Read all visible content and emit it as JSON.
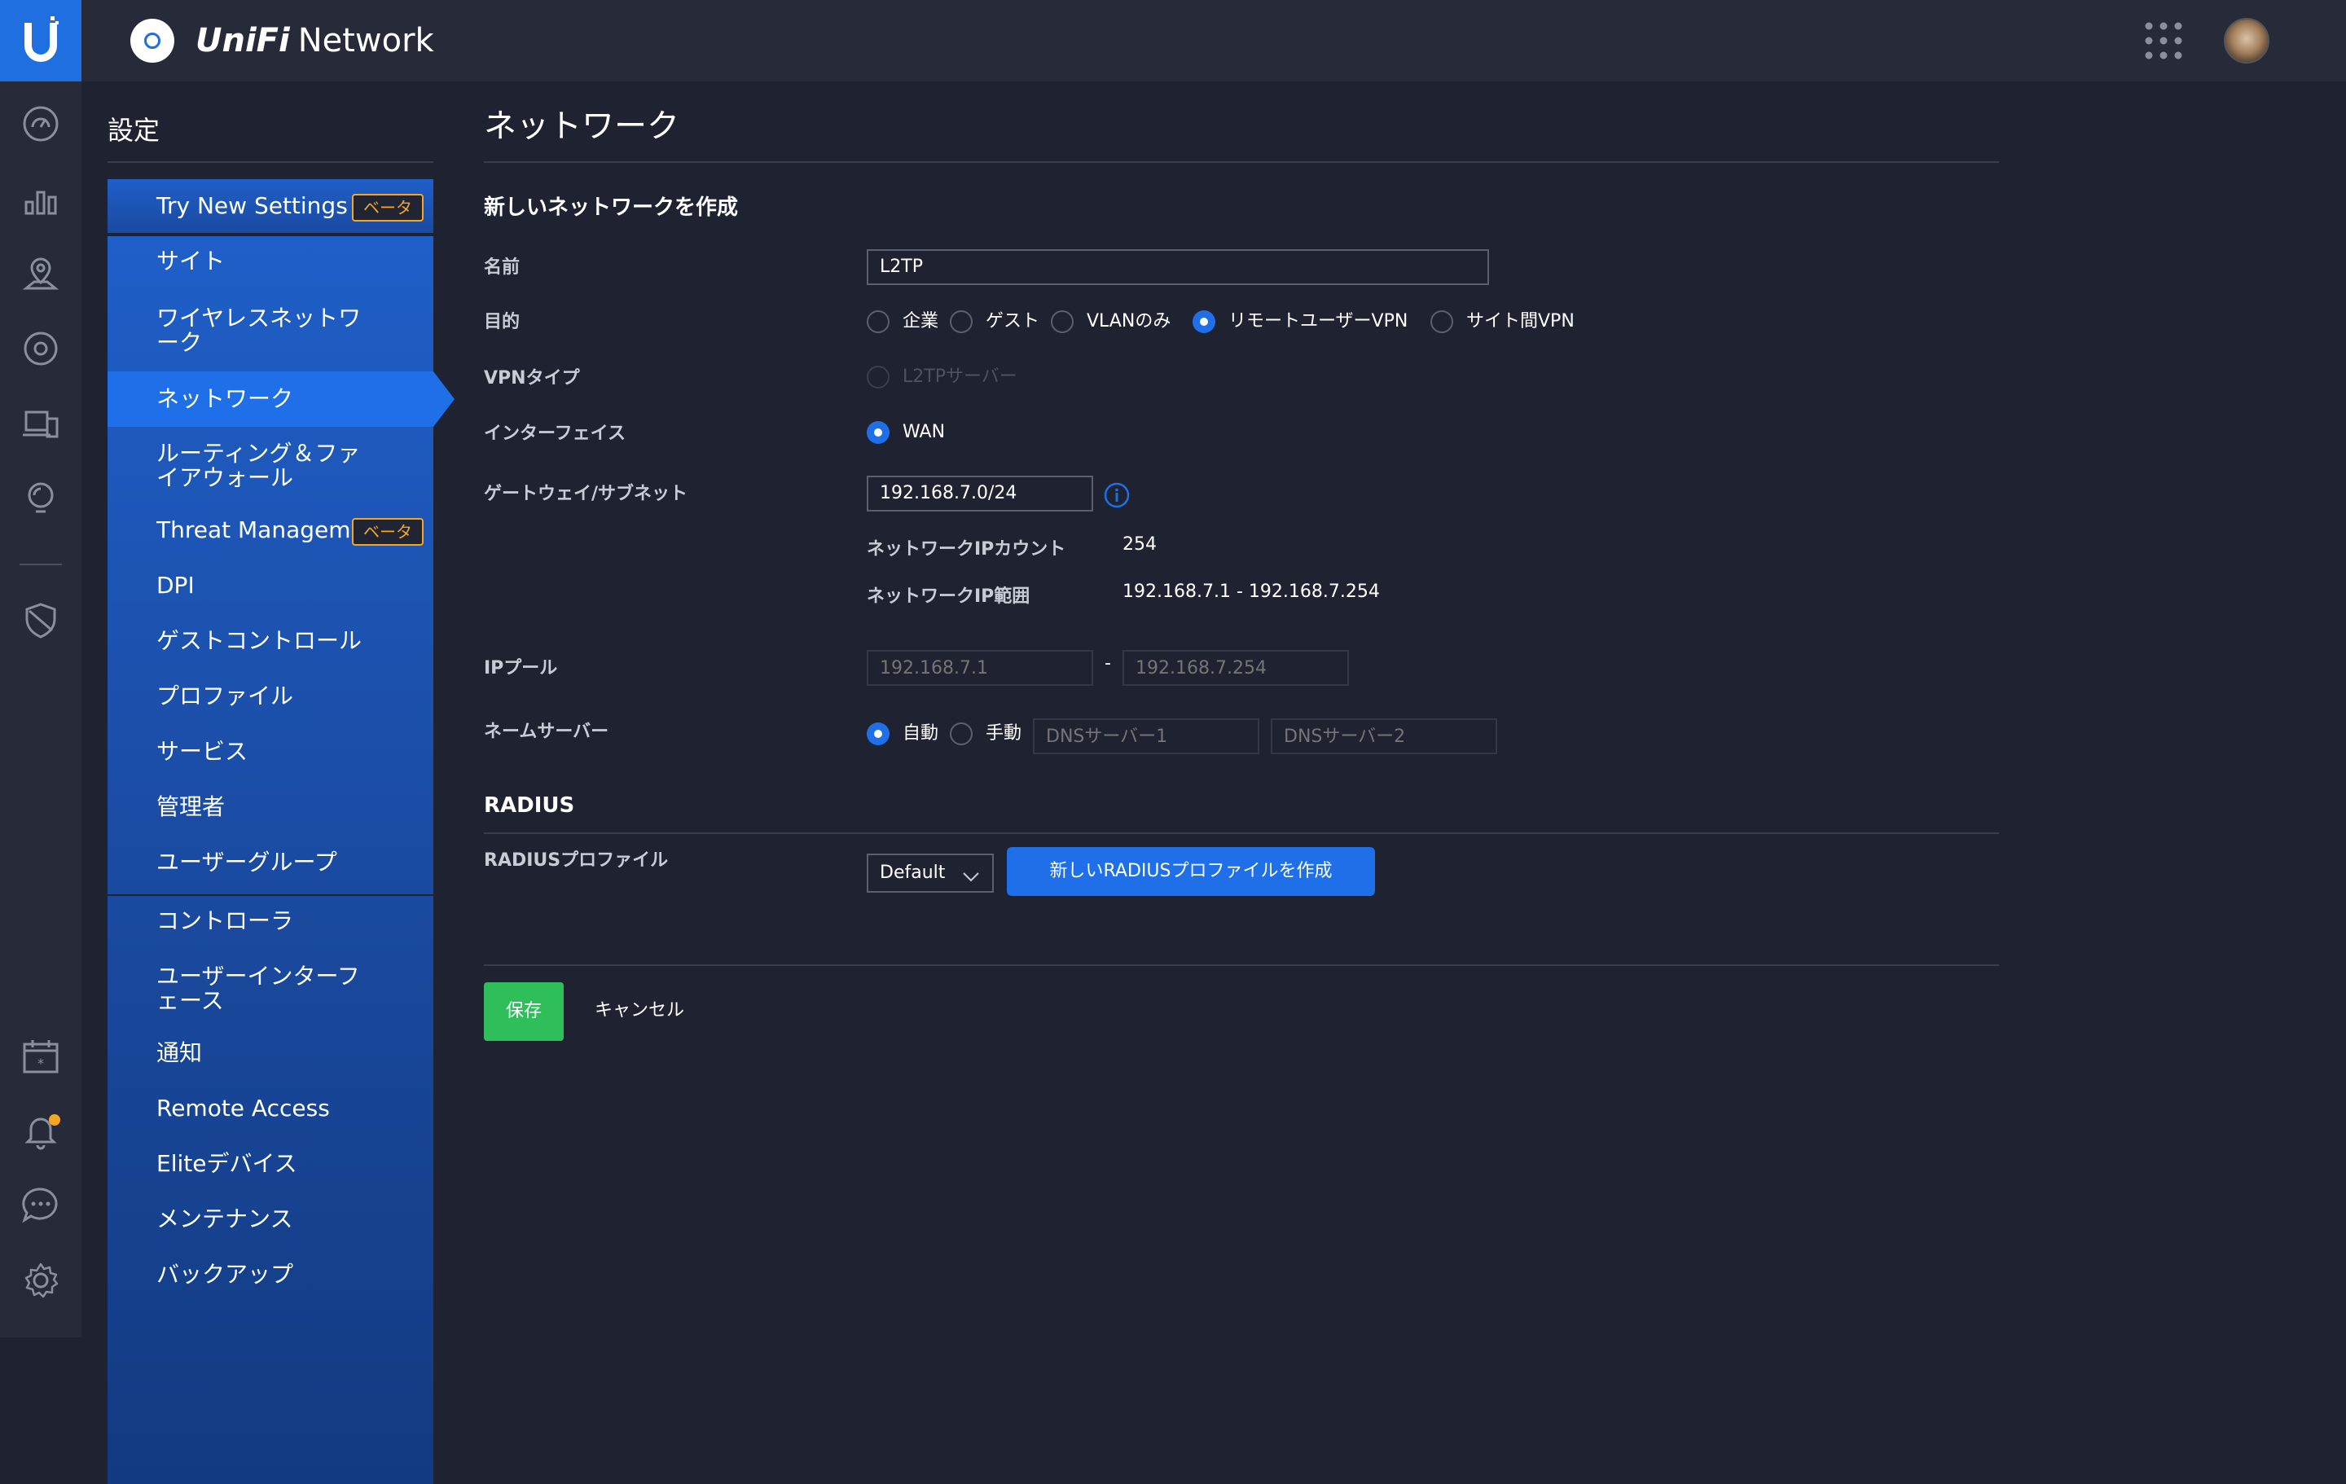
{
  "topbar": {
    "brand_part1": "UniFi",
    "brand_part2": "Network"
  },
  "settings": {
    "title": "設定",
    "items": [
      {
        "label": "Try New Settings",
        "badge": "ベータ"
      },
      {
        "label": "サイト"
      },
      {
        "label": "ワイヤレスネットワーク"
      },
      {
        "label": "ネットワーク",
        "active": true
      },
      {
        "label": "ルーティング＆ファイアウォール"
      },
      {
        "label": "Threat Management",
        "badge": "ベータ"
      },
      {
        "label": "DPI"
      },
      {
        "label": "ゲストコントロール"
      },
      {
        "label": "プロファイル"
      },
      {
        "label": "サービス"
      },
      {
        "label": "管理者"
      },
      {
        "label": "ユーザーグループ"
      },
      {
        "label": "コントローラ"
      },
      {
        "label": "ユーザーインターフェース"
      },
      {
        "label": "通知"
      },
      {
        "label": "Remote Access"
      },
      {
        "label": "Eliteデバイス"
      },
      {
        "label": "メンテナンス"
      },
      {
        "label": "バックアップ"
      }
    ]
  },
  "main": {
    "page_title": "ネットワーク",
    "section_title": "新しいネットワークを作成",
    "name": {
      "label": "名前",
      "value": "L2TP"
    },
    "purpose": {
      "label": "目的",
      "options": [
        "企業",
        "ゲスト",
        "VLANのみ",
        "リモートユーザーVPN",
        "サイト間VPN"
      ],
      "selected": "リモートユーザーVPN"
    },
    "vpn_type": {
      "label": "VPNタイプ",
      "option": "L2TPサーバー"
    },
    "interface": {
      "label": "インターフェイス",
      "option": "WAN"
    },
    "gateway": {
      "label": "ゲートウェイ/サブネット",
      "value": "192.168.7.0/24"
    },
    "ip_count": {
      "label": "ネットワークIPカウント",
      "value": "254"
    },
    "ip_range": {
      "label": "ネットワークIP範囲",
      "value": "192.168.7.1 - 192.168.7.254"
    },
    "ip_pool": {
      "label": "IPプール",
      "start_placeholder": "192.168.7.1",
      "separator": "-",
      "end_placeholder": "192.168.7.254"
    },
    "name_server": {
      "label": "ネームサーバー",
      "auto": "自動",
      "manual": "手動",
      "dns1_placeholder": "DNSサーバー1",
      "dns2_placeholder": "DNSサーバー2"
    },
    "radius": {
      "section_title": "RADIUS",
      "profile_label": "RADIUSプロファイル",
      "profile_value": "Default",
      "new_button": "新しいRADIUSプロファイルを作成"
    },
    "actions": {
      "save": "保存",
      "cancel": "キャンセル"
    }
  },
  "colors": {
    "accent": "#1f6fe8",
    "success": "#2fbf5a",
    "beta": "#f5a623",
    "background": "#1f2230",
    "rail": "#262a39"
  }
}
